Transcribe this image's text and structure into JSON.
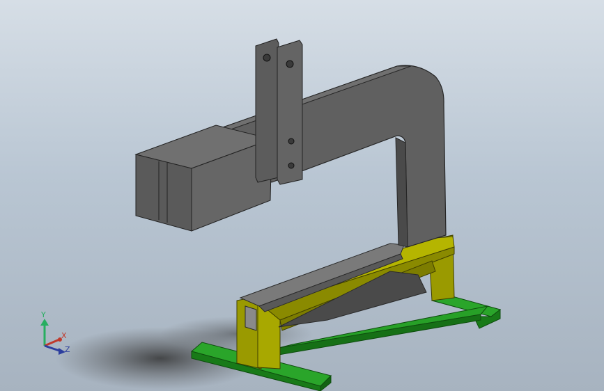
{
  "viewport": {
    "background_top": "#d6dee6",
    "background_bottom": "#a7b3c0"
  },
  "model": {
    "frame_color": "#5e5e5e",
    "support_color": "#8a8a00",
    "base_color": "#1f9a1f"
  },
  "triad": {
    "x_label": "X",
    "y_label": "Y",
    "z_label": "Z",
    "x_color": "#c0392b",
    "y_color": "#27ae60",
    "z_color": "#2c3e9e"
  }
}
